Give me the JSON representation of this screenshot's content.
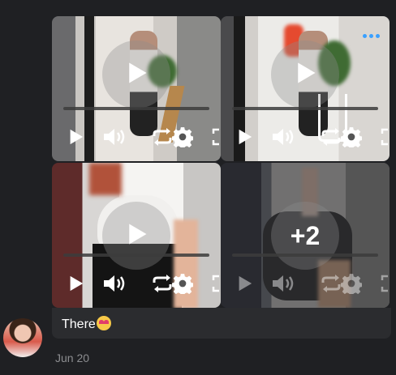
{
  "gallery": {
    "tiles": [
      {
        "kind": "video",
        "has_more_menu": false
      },
      {
        "kind": "video",
        "has_more_menu": true
      },
      {
        "kind": "video",
        "has_more_menu": false
      },
      {
        "kind": "video-overflow",
        "overflow_label": "+2"
      }
    ],
    "icons": {
      "play": "play-icon",
      "volume": "volume-icon",
      "loop": "loop-icon",
      "settings": "gear-icon",
      "fullscreen": "fullscreen-icon",
      "more": "more-dots-icon"
    }
  },
  "message": {
    "text": "There",
    "emoji": "smiling-face-with-hearts",
    "date": "Jun 20"
  },
  "colors": {
    "background": "#1f2023",
    "bubble": "#2b2c2f",
    "accent": "#3aa0ff",
    "date_text": "#8c8d90"
  }
}
